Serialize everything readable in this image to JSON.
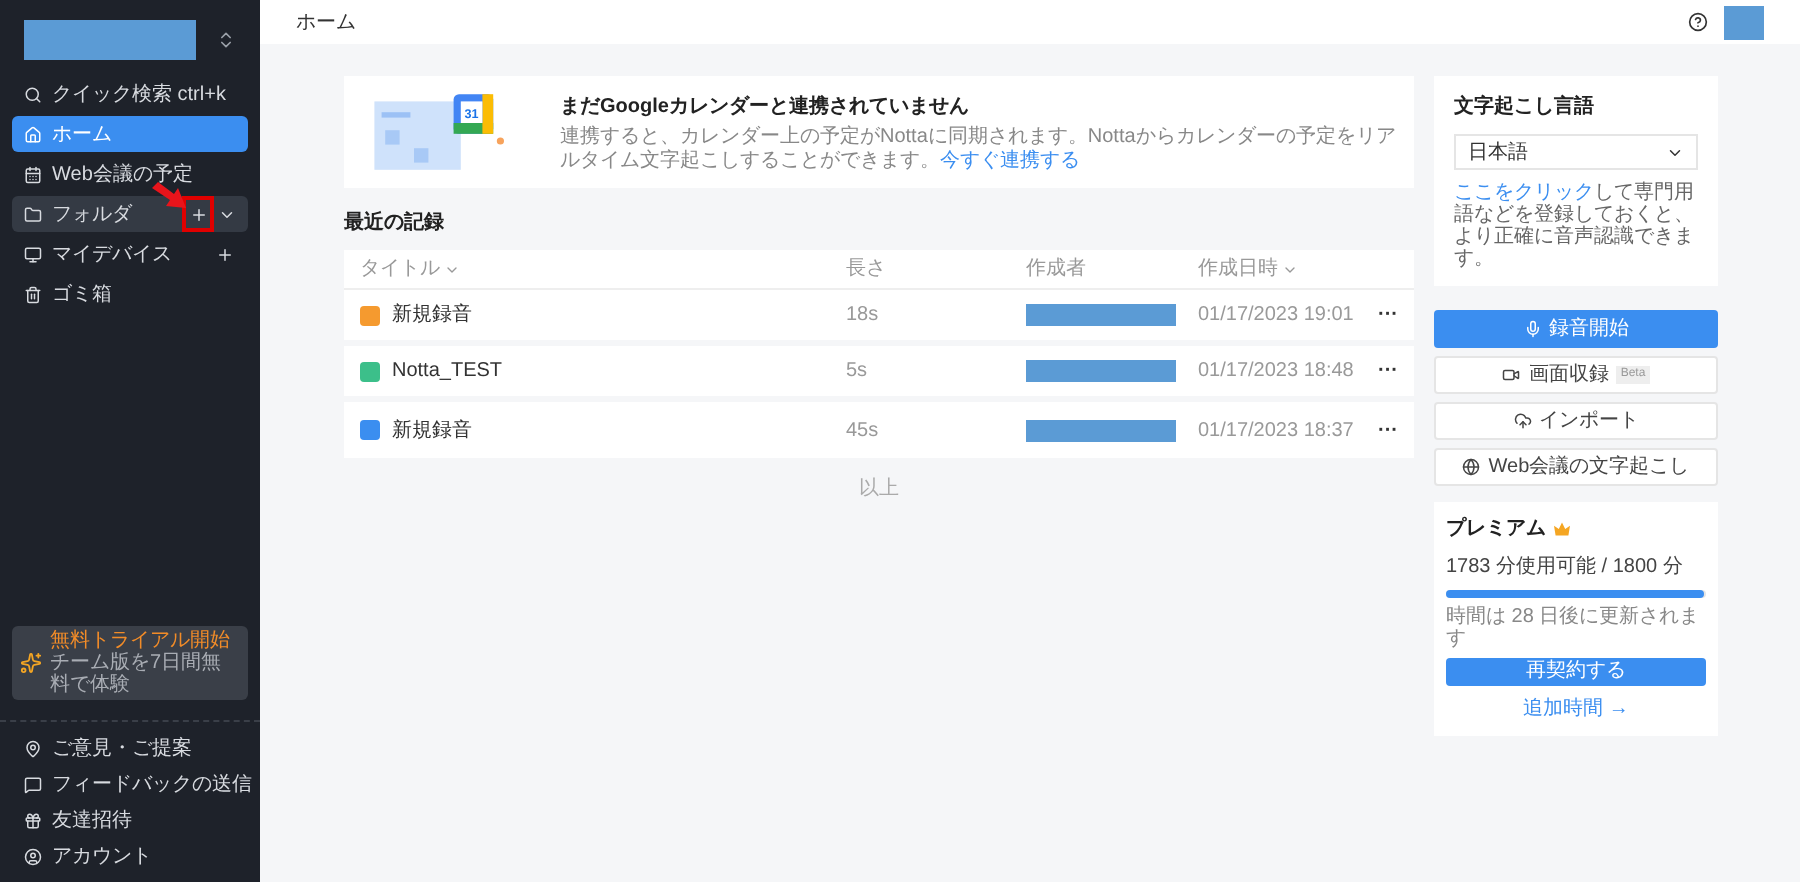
{
  "sidebar": {
    "search": {
      "label": "クイック検索 ctrl+k"
    },
    "items": [
      {
        "label": "ホーム",
        "selected": true,
        "hovered": false,
        "add": false,
        "expand": false
      },
      {
        "label": "Web会議の予定",
        "selected": false,
        "hovered": false,
        "add": false,
        "expand": false
      },
      {
        "label": "フォルダ",
        "selected": false,
        "hovered": true,
        "add": true,
        "expand": true
      },
      {
        "label": "マイデバイス",
        "selected": false,
        "hovered": false,
        "add": true,
        "expand": false
      },
      {
        "label": "ゴミ箱",
        "selected": false,
        "hovered": false,
        "add": false,
        "expand": false
      }
    ],
    "trial": {
      "title": "無料トライアル開始",
      "subtitle": "チーム版を7日間無料で体験"
    },
    "footer": [
      {
        "label": "ご意見・ご提案"
      },
      {
        "label": "フィードバックの送信"
      },
      {
        "label": "友達招待"
      },
      {
        "label": "アカウント"
      }
    ]
  },
  "breadcrumb": "ホーム",
  "banner": {
    "title": "まだGoogleカレンダーと連携されていません",
    "text": "連携すると、カレンダー上の予定がNottaに同期されます。Nottaからカレンダーの予定をリアルタイム文字起こしすることができます。",
    "link": "今すぐ連携する",
    "calendar_day": "31"
  },
  "recent": {
    "title": "最近の記録",
    "columns": [
      "タイトル",
      "長さ",
      "作成者",
      "作成日時"
    ],
    "rows": [
      {
        "title": "新規録音",
        "color": "#f59a2f",
        "length": "18s",
        "date": "01/17/2023 19:01",
        "more": "···"
      },
      {
        "title": "Notta_TEST",
        "color": "#3cbf8a",
        "length": "5s",
        "date": "01/17/2023 18:48",
        "more": "···"
      },
      {
        "title": "新規録音",
        "color": "#3b8ef0",
        "length": "45s",
        "date": "01/17/2023 18:37",
        "more": "···"
      }
    ],
    "end": "以上"
  },
  "language": {
    "title": "文字起こし言語",
    "value": "日本語",
    "link": "ここをクリック",
    "hint": "して専門用語などを登録しておくと、より正確に音声認識できます。"
  },
  "actions": [
    {
      "label": "録音開始",
      "kind": "primary"
    },
    {
      "label": "画面収録",
      "kind": "screen",
      "badge": "Beta"
    },
    {
      "label": "インポート",
      "kind": "import"
    },
    {
      "label": "Web会議の文字起こし",
      "kind": "meeting"
    }
  ],
  "premium": {
    "title": "プレミアム",
    "usage": "1783 分使用可能 / 1800 分",
    "level": 0.99,
    "renew": "時間は 28 日後に更新されます",
    "button": "再契約する",
    "link": "追加時間 →"
  }
}
